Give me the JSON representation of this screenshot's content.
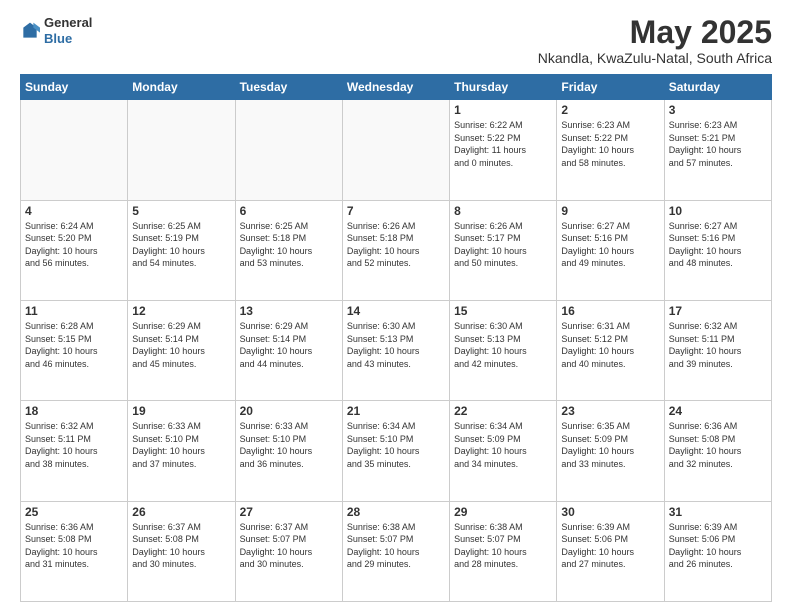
{
  "header": {
    "logo_general": "General",
    "logo_blue": "Blue",
    "month_title": "May 2025",
    "location": "Nkandla, KwaZulu-Natal, South Africa"
  },
  "days_of_week": [
    "Sunday",
    "Monday",
    "Tuesday",
    "Wednesday",
    "Thursday",
    "Friday",
    "Saturday"
  ],
  "weeks": [
    [
      {
        "day": "",
        "text": ""
      },
      {
        "day": "",
        "text": ""
      },
      {
        "day": "",
        "text": ""
      },
      {
        "day": "",
        "text": ""
      },
      {
        "day": "1",
        "text": "Sunrise: 6:22 AM\nSunset: 5:22 PM\nDaylight: 11 hours\nand 0 minutes."
      },
      {
        "day": "2",
        "text": "Sunrise: 6:23 AM\nSunset: 5:22 PM\nDaylight: 10 hours\nand 58 minutes."
      },
      {
        "day": "3",
        "text": "Sunrise: 6:23 AM\nSunset: 5:21 PM\nDaylight: 10 hours\nand 57 minutes."
      }
    ],
    [
      {
        "day": "4",
        "text": "Sunrise: 6:24 AM\nSunset: 5:20 PM\nDaylight: 10 hours\nand 56 minutes."
      },
      {
        "day": "5",
        "text": "Sunrise: 6:25 AM\nSunset: 5:19 PM\nDaylight: 10 hours\nand 54 minutes."
      },
      {
        "day": "6",
        "text": "Sunrise: 6:25 AM\nSunset: 5:18 PM\nDaylight: 10 hours\nand 53 minutes."
      },
      {
        "day": "7",
        "text": "Sunrise: 6:26 AM\nSunset: 5:18 PM\nDaylight: 10 hours\nand 52 minutes."
      },
      {
        "day": "8",
        "text": "Sunrise: 6:26 AM\nSunset: 5:17 PM\nDaylight: 10 hours\nand 50 minutes."
      },
      {
        "day": "9",
        "text": "Sunrise: 6:27 AM\nSunset: 5:16 PM\nDaylight: 10 hours\nand 49 minutes."
      },
      {
        "day": "10",
        "text": "Sunrise: 6:27 AM\nSunset: 5:16 PM\nDaylight: 10 hours\nand 48 minutes."
      }
    ],
    [
      {
        "day": "11",
        "text": "Sunrise: 6:28 AM\nSunset: 5:15 PM\nDaylight: 10 hours\nand 46 minutes."
      },
      {
        "day": "12",
        "text": "Sunrise: 6:29 AM\nSunset: 5:14 PM\nDaylight: 10 hours\nand 45 minutes."
      },
      {
        "day": "13",
        "text": "Sunrise: 6:29 AM\nSunset: 5:14 PM\nDaylight: 10 hours\nand 44 minutes."
      },
      {
        "day": "14",
        "text": "Sunrise: 6:30 AM\nSunset: 5:13 PM\nDaylight: 10 hours\nand 43 minutes."
      },
      {
        "day": "15",
        "text": "Sunrise: 6:30 AM\nSunset: 5:13 PM\nDaylight: 10 hours\nand 42 minutes."
      },
      {
        "day": "16",
        "text": "Sunrise: 6:31 AM\nSunset: 5:12 PM\nDaylight: 10 hours\nand 40 minutes."
      },
      {
        "day": "17",
        "text": "Sunrise: 6:32 AM\nSunset: 5:11 PM\nDaylight: 10 hours\nand 39 minutes."
      }
    ],
    [
      {
        "day": "18",
        "text": "Sunrise: 6:32 AM\nSunset: 5:11 PM\nDaylight: 10 hours\nand 38 minutes."
      },
      {
        "day": "19",
        "text": "Sunrise: 6:33 AM\nSunset: 5:10 PM\nDaylight: 10 hours\nand 37 minutes."
      },
      {
        "day": "20",
        "text": "Sunrise: 6:33 AM\nSunset: 5:10 PM\nDaylight: 10 hours\nand 36 minutes."
      },
      {
        "day": "21",
        "text": "Sunrise: 6:34 AM\nSunset: 5:10 PM\nDaylight: 10 hours\nand 35 minutes."
      },
      {
        "day": "22",
        "text": "Sunrise: 6:34 AM\nSunset: 5:09 PM\nDaylight: 10 hours\nand 34 minutes."
      },
      {
        "day": "23",
        "text": "Sunrise: 6:35 AM\nSunset: 5:09 PM\nDaylight: 10 hours\nand 33 minutes."
      },
      {
        "day": "24",
        "text": "Sunrise: 6:36 AM\nSunset: 5:08 PM\nDaylight: 10 hours\nand 32 minutes."
      }
    ],
    [
      {
        "day": "25",
        "text": "Sunrise: 6:36 AM\nSunset: 5:08 PM\nDaylight: 10 hours\nand 31 minutes."
      },
      {
        "day": "26",
        "text": "Sunrise: 6:37 AM\nSunset: 5:08 PM\nDaylight: 10 hours\nand 30 minutes."
      },
      {
        "day": "27",
        "text": "Sunrise: 6:37 AM\nSunset: 5:07 PM\nDaylight: 10 hours\nand 30 minutes."
      },
      {
        "day": "28",
        "text": "Sunrise: 6:38 AM\nSunset: 5:07 PM\nDaylight: 10 hours\nand 29 minutes."
      },
      {
        "day": "29",
        "text": "Sunrise: 6:38 AM\nSunset: 5:07 PM\nDaylight: 10 hours\nand 28 minutes."
      },
      {
        "day": "30",
        "text": "Sunrise: 6:39 AM\nSunset: 5:06 PM\nDaylight: 10 hours\nand 27 minutes."
      },
      {
        "day": "31",
        "text": "Sunrise: 6:39 AM\nSunset: 5:06 PM\nDaylight: 10 hours\nand 26 minutes."
      }
    ]
  ]
}
